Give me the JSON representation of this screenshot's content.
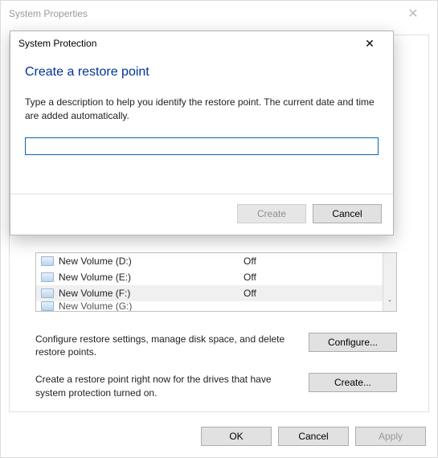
{
  "sysprop": {
    "title": "System Properties",
    "drives": [
      {
        "name": "New Volume (D:)",
        "status": "Off"
      },
      {
        "name": "New Volume (E:)",
        "status": "Off"
      },
      {
        "name": "New Volume (F:)",
        "status": "Off"
      }
    ],
    "partial_drive": "New Volume (G:)",
    "configure_text": "Configure restore settings, manage disk space, and delete restore points.",
    "configure_btn": "Configure...",
    "create_text": "Create a restore point right now for the drives that have system protection turned on.",
    "create_btn": "Create...",
    "ok_btn": "OK",
    "cancel_btn": "Cancel",
    "apply_btn": "Apply"
  },
  "dialog": {
    "title": "System Protection",
    "heading": "Create a restore point",
    "instruction": "Type a description to help you identify the restore point. The current date and time are added automatically.",
    "input_value": "",
    "create_btn": "Create",
    "cancel_btn": "Cancel"
  }
}
